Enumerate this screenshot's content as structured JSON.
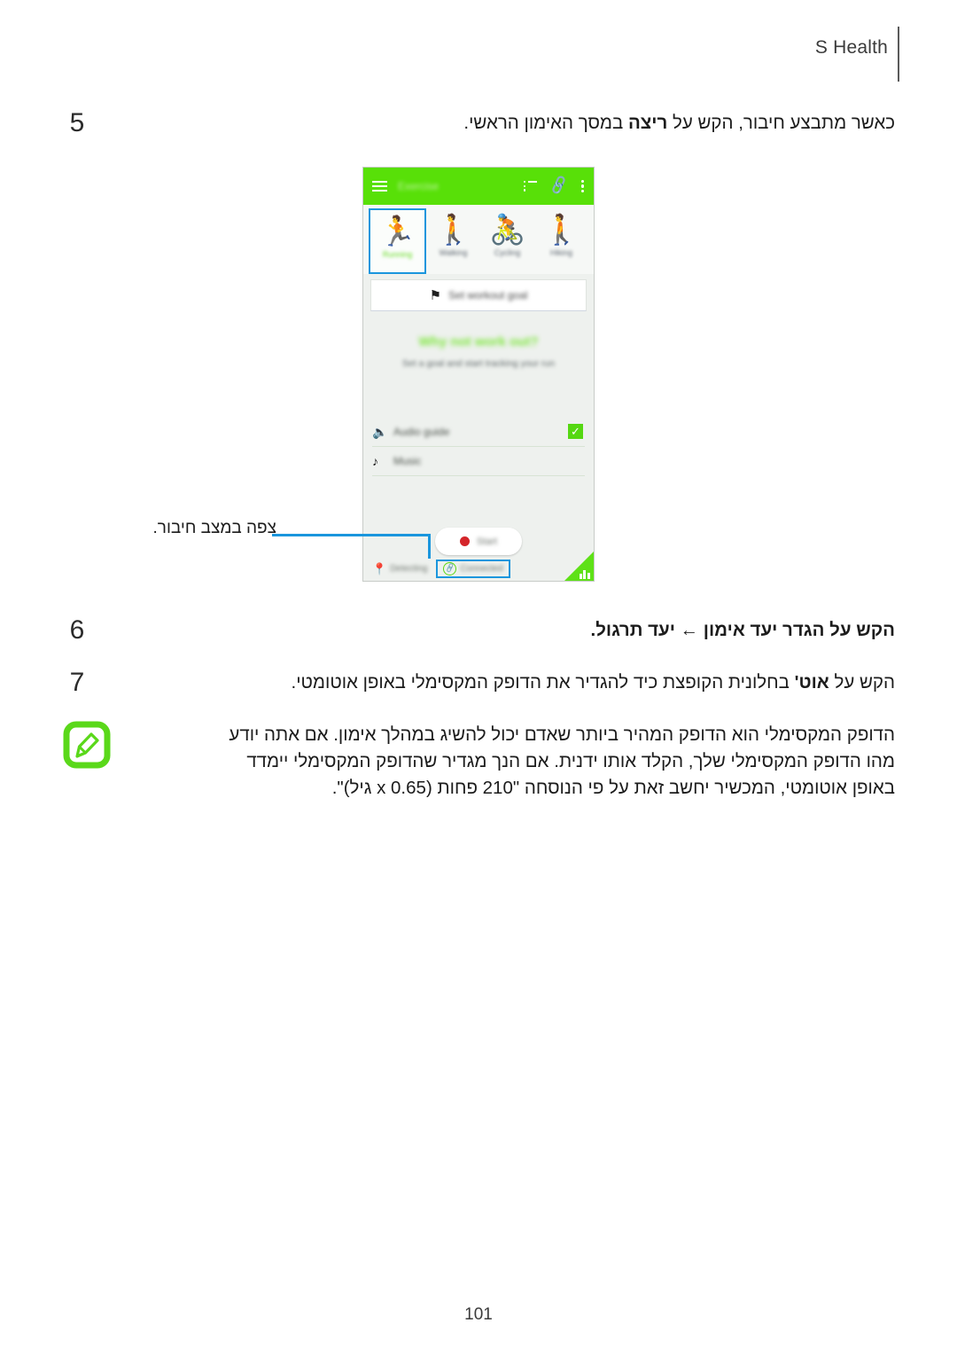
{
  "header": {
    "title": "S Health"
  },
  "steps": [
    {
      "number": "5",
      "text_before": "כאשר מתבצע חיבור, הקש על ",
      "bold": "ריצה",
      "text_after": " במסך האימון הראשי."
    },
    {
      "number": "6",
      "text_before": "הקש על ",
      "bold": "הגדר יעד אימון ← יעד תרגול",
      "text_after": "."
    },
    {
      "number": "7",
      "text_before": "הקש על ",
      "bold": "אוט'",
      "text_after": " בחלונית הקופצת כיד להגדיר את הדופק המקסימלי באופן אוטומטי."
    }
  ],
  "note": {
    "icon": "note-pencil-icon",
    "lines": [
      "הדופק המקסימלי הוא הדופק המהיר ביותר שאדם יכול להשיג במהלך אימון. אם אתה יודע",
      "מהו הדופק המקסימלי שלך, הקלד אותו ידנית. אם הנך מגדיר שהדופק המקסימלי יימדד",
      "באופן אוטומטי, המכשיר יחשב זאת על פי הנוסחה \"210 פחות (0.65 x גיל)\"."
    ]
  },
  "callout": {
    "label": "צפה במצב חיבור."
  },
  "phone": {
    "topbar": {
      "menu_icon": "hamburger-icon",
      "title": "Exercise",
      "list_icon": "list-icon",
      "link_icon": "link-icon",
      "more_icon": "overflow-menu-icon"
    },
    "modes": [
      {
        "label": "Running",
        "icon": "running-icon",
        "selected": true
      },
      {
        "label": "Walking",
        "icon": "walking-icon",
        "selected": false
      },
      {
        "label": "Cycling",
        "icon": "cycling-icon",
        "selected": false
      },
      {
        "label": "Hiking",
        "icon": "hiking-icon",
        "selected": false
      }
    ],
    "goal_button": {
      "icon": "flag-icon",
      "label": "Set workout goal"
    },
    "promo": {
      "title": "Why not work out?",
      "subtitle": "Set a goal and start tracking your run"
    },
    "options": [
      {
        "label": "Audio guide",
        "icon": "speaker-icon",
        "checked": true
      },
      {
        "label": "Music",
        "icon": "music-note-icon",
        "checked": false
      }
    ],
    "start_button": {
      "label": "Start",
      "icon": "record-dot-icon"
    },
    "status": [
      {
        "label": "Detecting",
        "icon": "location-pin-icon",
        "highlighted": false
      },
      {
        "label": "Connected",
        "icon": "link-connected-icon",
        "highlighted": true
      }
    ],
    "corner": {
      "icon": "bar-chart-icon"
    }
  },
  "colors": {
    "brand_green": "#58e008",
    "highlight_blue": "#1a96dd",
    "record_red": "#d4252a"
  },
  "footer": {
    "page_number": "101"
  }
}
